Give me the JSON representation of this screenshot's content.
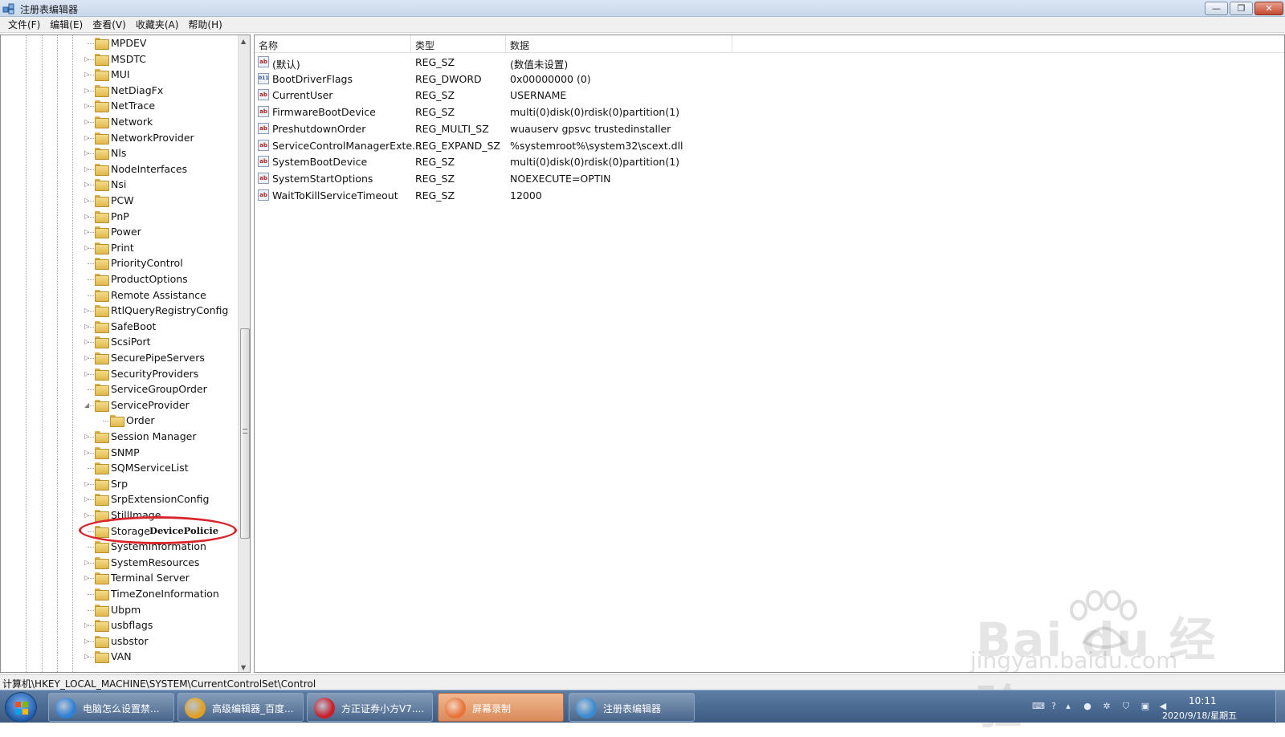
{
  "window": {
    "title": "注册表编辑器",
    "controls": {
      "minimize": "—",
      "maximize": "❐",
      "close": "✕"
    }
  },
  "menu": [
    "文件(F)",
    "编辑(E)",
    "查看(V)",
    "收藏夹(A)",
    "帮助(H)"
  ],
  "tree": {
    "items": [
      {
        "label": "MPDEV",
        "expander": ""
      },
      {
        "label": "MSDTC",
        "expander": "▷"
      },
      {
        "label": "MUI",
        "expander": "▷"
      },
      {
        "label": "NetDiagFx",
        "expander": "▷"
      },
      {
        "label": "NetTrace",
        "expander": "▷"
      },
      {
        "label": "Network",
        "expander": "▷"
      },
      {
        "label": "NetworkProvider",
        "expander": "▷"
      },
      {
        "label": "Nls",
        "expander": "▷"
      },
      {
        "label": "NodeInterfaces",
        "expander": "▷"
      },
      {
        "label": "Nsi",
        "expander": "▷"
      },
      {
        "label": "PCW",
        "expander": "▷"
      },
      {
        "label": "PnP",
        "expander": "▷"
      },
      {
        "label": "Power",
        "expander": "▷"
      },
      {
        "label": "Print",
        "expander": "▷"
      },
      {
        "label": "PriorityControl",
        "expander": ""
      },
      {
        "label": "ProductOptions",
        "expander": ""
      },
      {
        "label": "Remote Assistance",
        "expander": ""
      },
      {
        "label": "RtlQueryRegistryConfig",
        "expander": "▷"
      },
      {
        "label": "SafeBoot",
        "expander": "▷"
      },
      {
        "label": "ScsiPort",
        "expander": "▷"
      },
      {
        "label": "SecurePipeServers",
        "expander": "▷"
      },
      {
        "label": "SecurityProviders",
        "expander": "▷"
      },
      {
        "label": "ServiceGroupOrder",
        "expander": ""
      },
      {
        "label": "ServiceProvider",
        "expander": "◢"
      },
      {
        "label": "Order",
        "expander": "",
        "child": true
      },
      {
        "label": "Session Manager",
        "expander": "▷"
      },
      {
        "label": "SNMP",
        "expander": "▷"
      },
      {
        "label": "SQMServiceList",
        "expander": ""
      },
      {
        "label": "Srp",
        "expander": "▷"
      },
      {
        "label": "SrpExtensionConfig",
        "expander": "▷"
      },
      {
        "label": "StillImage",
        "expander": "▷"
      },
      {
        "label": "Storage",
        "expander": "",
        "suffix": "DevicePolicie"
      },
      {
        "label": "SystemInformation",
        "expander": ""
      },
      {
        "label": "SystemResources",
        "expander": "▷"
      },
      {
        "label": "Terminal Server",
        "expander": "▷"
      },
      {
        "label": "TimeZoneInformation",
        "expander": ""
      },
      {
        "label": "Ubpm",
        "expander": ""
      },
      {
        "label": "usbflags",
        "expander": "▷"
      },
      {
        "label": "usbstor",
        "expander": "▷"
      },
      {
        "label": "VAN",
        "expander": "▷"
      }
    ]
  },
  "list": {
    "columns": [
      "名称",
      "类型",
      "数据"
    ],
    "rows": [
      {
        "icon": "ab",
        "name": "(默认)",
        "type": "REG_SZ",
        "data": "(数值未设置)"
      },
      {
        "icon": "bin",
        "name": "BootDriverFlags",
        "type": "REG_DWORD",
        "data": "0x00000000 (0)"
      },
      {
        "icon": "ab",
        "name": "CurrentUser",
        "type": "REG_SZ",
        "data": "USERNAME"
      },
      {
        "icon": "ab",
        "name": "FirmwareBootDevice",
        "type": "REG_SZ",
        "data": "multi(0)disk(0)rdisk(0)partition(1)"
      },
      {
        "icon": "ab",
        "name": "PreshutdownOrder",
        "type": "REG_MULTI_SZ",
        "data": "wuauserv gpsvc trustedinstaller"
      },
      {
        "icon": "ab",
        "name": "ServiceControlManagerExte...",
        "type": "REG_EXPAND_SZ",
        "data": "%systemroot%\\system32\\scext.dll"
      },
      {
        "icon": "ab",
        "name": "SystemBootDevice",
        "type": "REG_SZ",
        "data": "multi(0)disk(0)rdisk(0)partition(1)"
      },
      {
        "icon": "ab",
        "name": "SystemStartOptions",
        "type": "REG_SZ",
        "data": " NOEXECUTE=OPTIN"
      },
      {
        "icon": "ab",
        "name": "WaitToKillServiceTimeout",
        "type": "REG_SZ",
        "data": "12000"
      }
    ]
  },
  "status": {
    "path": "计算机\\HKEY_LOCAL_MACHINE\\SYSTEM\\CurrentControlSet\\Control"
  },
  "taskbar": {
    "buttons": [
      {
        "label": "电脑怎么设置禁...",
        "icon": "ie-icon",
        "color": "#2e7fd6",
        "active": false
      },
      {
        "label": "高级编辑器_百度...",
        "icon": "chrome-icon",
        "color": "#e0a020",
        "active": false
      },
      {
        "label": "方正证券小方V7....",
        "icon": "stock-app-icon",
        "color": "#c8202a",
        "active": false
      },
      {
        "label": "屏幕录制",
        "icon": "screen-recorder-icon",
        "color": "#e8743a",
        "active": true
      },
      {
        "label": "注册表编辑器",
        "icon": "regedit-icon",
        "color": "#3a8ad0",
        "active": false
      }
    ],
    "clock": {
      "time": "10:11",
      "date": "2020/9/18/星期五"
    }
  },
  "watermark": {
    "brand": "Bai du 经验",
    "url": "jingyan.baidu.com"
  },
  "colors": {
    "annotation": "#d9252c",
    "taskbar": "#4a6a92"
  }
}
